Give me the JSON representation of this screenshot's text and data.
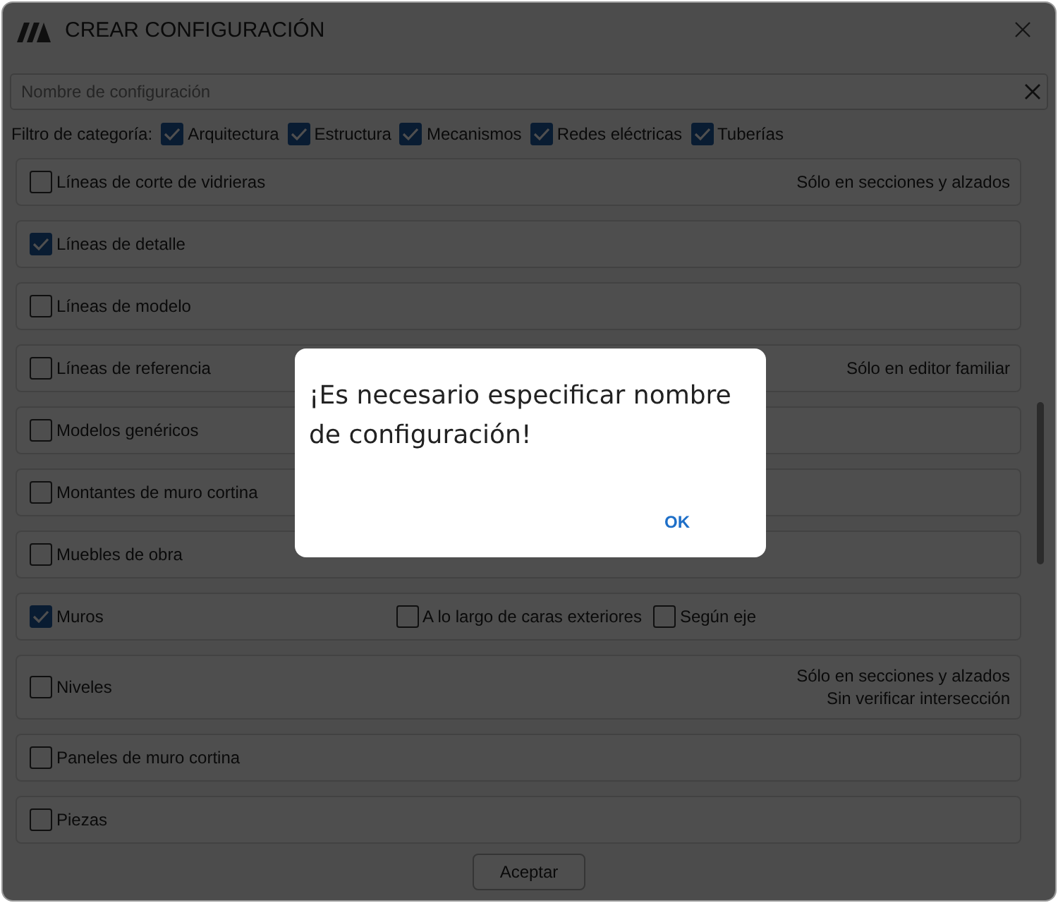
{
  "window": {
    "title": "CREAR CONFIGURACIÓN"
  },
  "search": {
    "placeholder": "Nombre de configuración"
  },
  "filter": {
    "label": "Filtro de categoría:",
    "items": [
      {
        "label": "Arquitectura",
        "checked": true
      },
      {
        "label": "Estructura",
        "checked": true
      },
      {
        "label": "Mecanismos",
        "checked": true
      },
      {
        "label": "Redes eléctricas",
        "checked": true
      },
      {
        "label": "Tuberías",
        "checked": true
      }
    ]
  },
  "rows": [
    {
      "kind": "plain",
      "label": "Líneas de corte de vidrieras",
      "checked": false,
      "notes": [
        "Sólo en secciones y alzados"
      ]
    },
    {
      "kind": "plain",
      "label": "Líneas de detalle",
      "checked": true
    },
    {
      "kind": "plain",
      "label": "Líneas de modelo",
      "checked": false
    },
    {
      "kind": "plain",
      "label": "Líneas de referencia",
      "checked": false,
      "notes": [
        "Sólo en editor familiar"
      ]
    },
    {
      "kind": "plain",
      "label": "Modelos genéricos",
      "checked": false
    },
    {
      "kind": "plain",
      "label": "Montantes de muro cortina",
      "checked": false
    },
    {
      "kind": "plain",
      "label": "Muebles de obra",
      "checked": false
    },
    {
      "kind": "options",
      "label": "Muros",
      "checked": true,
      "options": [
        {
          "label": "A lo largo de caras exteriores",
          "checked": false
        },
        {
          "label": "Según eje",
          "checked": false
        }
      ]
    },
    {
      "kind": "plain",
      "label": "Niveles",
      "checked": false,
      "notes": [
        "Sólo en secciones y alzados",
        "Sin verificar intersección"
      ]
    },
    {
      "kind": "plain",
      "label": "Paneles de muro cortina",
      "checked": false
    },
    {
      "kind": "plain",
      "label": "Piezas",
      "checked": false
    }
  ],
  "accept_button": "Aceptar",
  "dialog": {
    "message": "¡Es necesario especificar nombre de configuración!",
    "button": "OK"
  }
}
